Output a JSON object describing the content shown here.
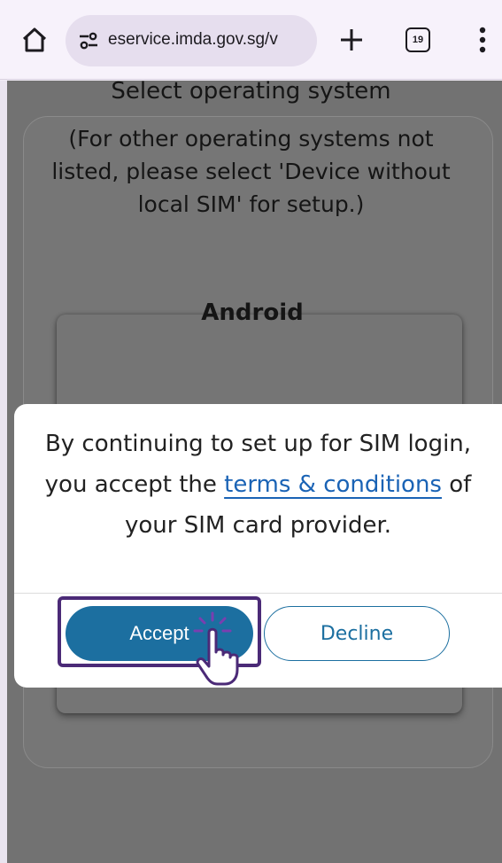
{
  "browser": {
    "url": "eservice.imda.gov.sg/v",
    "tab_count": "19"
  },
  "page": {
    "title": "Select operating system",
    "note": "(For other operating systems not listed, please select 'Device without local SIM' for setup.)",
    "option": "Android"
  },
  "modal": {
    "text_before": "By continuing to set up for SIM login, you accept the ",
    "link_text": "terms & conditions",
    "text_after": " of your SIM card provider.",
    "accept_label": "Accept",
    "decline_label": "Decline"
  },
  "colors": {
    "accent": "#1c6fa0",
    "link": "#1a63b5",
    "highlight": "#4b2a77"
  },
  "icons": [
    "home-icon",
    "tune-icon",
    "plus-icon",
    "more-vert-icon",
    "hand-cursor-icon"
  ]
}
